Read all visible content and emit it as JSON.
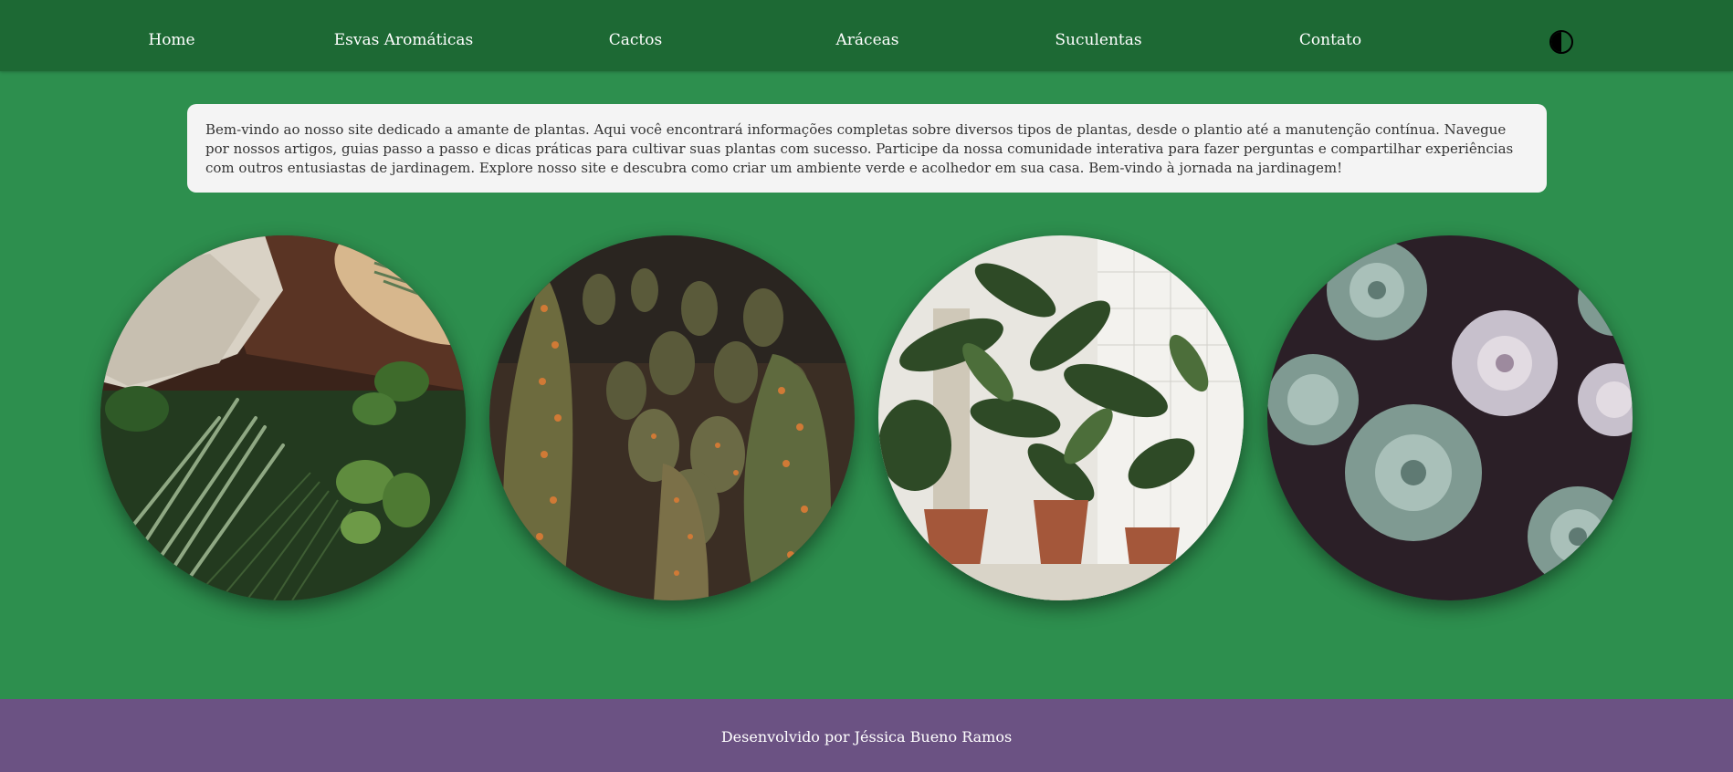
{
  "nav": {
    "items": [
      {
        "label": "Home"
      },
      {
        "label": "Esvas Aromáticas"
      },
      {
        "label": "Cactos"
      },
      {
        "label": "Aráceas"
      },
      {
        "label": "Suculentas"
      },
      {
        "label": "Contato"
      }
    ],
    "theme_toggle_icon": "contrast-icon"
  },
  "intro": {
    "text": "Bem-vindo ao nosso site dedicado a amante de plantas. Aqui você encontrará informações completas sobre diversos tipos de plantas, desde o plantio até a manutenção contínua. Navegue por nossos artigos, guias passo a passo e dicas práticas para cultivar suas plantas com sucesso. Participe da nossa comunidade interativa para fazer perguntas e compartilhar experiências com outros entusiastas de jardinagem. Explore nosso site e descubra como criar um ambiente verde e acolhedor em sua casa. Bem-vindo à jornada na jardinagem!"
  },
  "gallery": {
    "images": [
      {
        "icon": "herbs-photo"
      },
      {
        "icon": "cactus-photo"
      },
      {
        "icon": "aroid-plants-photo"
      },
      {
        "icon": "succulents-photo"
      }
    ]
  },
  "footer": {
    "text": "Desenvolvido por Jéssica Bueno Ramos"
  },
  "colors": {
    "background": "#2d8f4e",
    "navbar": "#1d6934",
    "footer": "#6b5283",
    "card": "#f4f4f4"
  }
}
